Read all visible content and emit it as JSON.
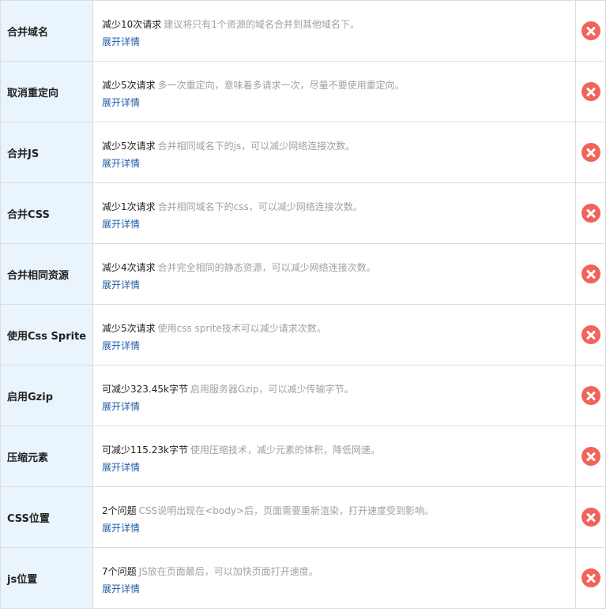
{
  "colors": {
    "name_cell_bg": "#eaf4fc",
    "link": "#1f5aa6",
    "hint_text": "#a0a0a0",
    "fail_icon": "#f0645a"
  },
  "rules": [
    {
      "name": "合并域名",
      "headline": "减少10次请求",
      "hint": "建议将只有1个资源的域名合并到其他域名下。",
      "more": "展开详情",
      "status_icon": "fail-icon"
    },
    {
      "name": "取消重定向",
      "headline": "减少5次请求",
      "hint": "多一次重定向，意味着多请求一次，尽量不要使用重定向。",
      "more": "展开详情",
      "status_icon": "fail-icon"
    },
    {
      "name": "合并JS",
      "headline": "减少5次请求",
      "hint": "合并相同域名下的js，可以减少网络连接次数。",
      "more": "展开详情",
      "status_icon": "fail-icon"
    },
    {
      "name": "合并CSS",
      "headline": "减少1次请求",
      "hint": "合并相同域名下的css，可以减少网络连接次数。",
      "more": "展开详情",
      "status_icon": "fail-icon"
    },
    {
      "name": "合并相同资源",
      "headline": "减少4次请求",
      "hint": "合并完全相同的静态资源，可以减少网络连接次数。",
      "more": "展开详情",
      "status_icon": "fail-icon"
    },
    {
      "name": "使用Css Sprite",
      "headline": "减少5次请求",
      "hint": "使用css sprite技术可以减少请求次数。",
      "more": "展开详情",
      "status_icon": "fail-icon"
    },
    {
      "name": "启用Gzip",
      "headline": "可减少323.45k字节",
      "hint": "启用服务器Gzip，可以减少传输字节。",
      "more": "展开详情",
      "status_icon": "fail-icon"
    },
    {
      "name": "压缩元素",
      "headline": "可减少115.23k字节",
      "hint": "使用压缩技术，减少元素的体积，降低网速。",
      "more": "展开详情",
      "status_icon": "fail-icon"
    },
    {
      "name": "CSS位置",
      "headline": "2个问题",
      "hint": "CSS说明出现在<body>后，页面需要重新渲染，打开速度受到影响。",
      "more": "展开详情",
      "status_icon": "fail-icon"
    },
    {
      "name": "js位置",
      "headline": "7个问题",
      "hint": "JS放在页面最后，可以加快页面打开速度。",
      "more": "展开详情",
      "status_icon": "fail-icon"
    }
  ]
}
